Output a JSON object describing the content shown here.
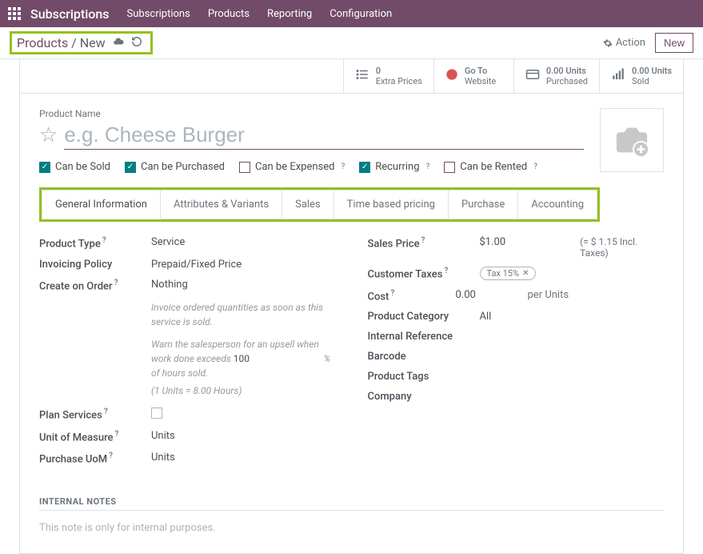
{
  "topbar": {
    "brand": "Subscriptions",
    "menu": [
      "Subscriptions",
      "Products",
      "Reporting",
      "Configuration"
    ]
  },
  "controlbar": {
    "breadcrumb_link": "Products",
    "breadcrumb_sep": " / ",
    "breadcrumb_current": "New",
    "action_label": "Action",
    "new_label": "New"
  },
  "stats": {
    "extra_prices": {
      "val": "0",
      "label": "Extra Prices"
    },
    "website": {
      "val": "Go To",
      "label": "Website"
    },
    "purchased": {
      "val": "0.00 Units",
      "label": "Purchased"
    },
    "sold": {
      "val": "0.00 Units",
      "label": "Sold"
    }
  },
  "product": {
    "name_label": "Product Name",
    "name_placeholder": "e.g. Cheese Burger"
  },
  "checks": {
    "sold": "Can be Sold",
    "purchased": "Can be Purchased",
    "expensed": "Can be Expensed",
    "recurring": "Recurring",
    "rented": "Can be Rented"
  },
  "tabs": [
    "General Information",
    "Attributes & Variants",
    "Sales",
    "Time based pricing",
    "Purchase",
    "Accounting"
  ],
  "form": {
    "left": {
      "product_type": {
        "label": "Product Type",
        "value": "Service"
      },
      "invoicing_policy": {
        "label": "Invoicing Policy",
        "value": "Prepaid/Fixed Price"
      },
      "create_on_order": {
        "label": "Create on Order",
        "value": "Nothing"
      },
      "hint1": "Invoice ordered quantities as soon as this service is sold.",
      "hint2a": "Warn the salesperson for an upsell when work done exceeds",
      "hint2_num": "100",
      "hint2b": "% of hours sold.",
      "hint3": "(1 Units = 8.00 Hours)",
      "plan_services": {
        "label": "Plan Services"
      },
      "uom": {
        "label": "Unit of Measure",
        "value": "Units"
      },
      "purchase_uom": {
        "label": "Purchase UoM",
        "value": "Units"
      }
    },
    "right": {
      "sales_price": {
        "label": "Sales Price",
        "value": "$1.00",
        "note": "(= $ 1.15 Incl. Taxes)"
      },
      "customer_taxes": {
        "label": "Customer Taxes",
        "tag": "Tax 15%"
      },
      "cost": {
        "label": "Cost",
        "value": "0.00",
        "unit": "per Units"
      },
      "product_category": {
        "label": "Product Category",
        "value": "All"
      },
      "internal_reference": {
        "label": "Internal Reference"
      },
      "barcode": {
        "label": "Barcode"
      },
      "product_tags": {
        "label": "Product Tags"
      },
      "company": {
        "label": "Company"
      }
    }
  },
  "internal_notes": {
    "title": "INTERNAL NOTES",
    "placeholder": "This note is only for internal purposes."
  }
}
